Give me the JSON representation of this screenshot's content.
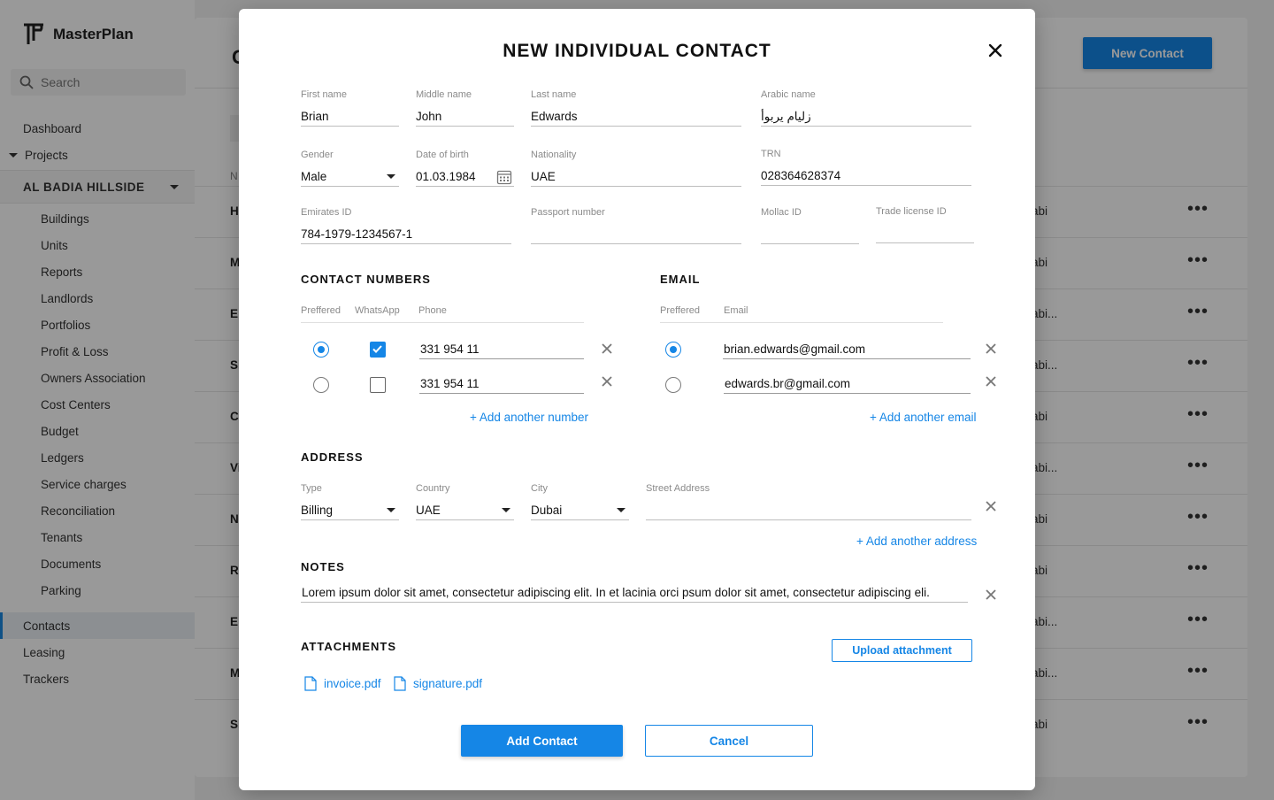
{
  "app": {
    "brand": "MasterPlan",
    "search_placeholder": "Search",
    "nav": {
      "dashboard": "Dashboard",
      "projects": "Projects",
      "project_name": "AL BADIA HILLSIDE",
      "project_items": [
        "Buildings",
        "Units",
        "Reports",
        "Landlords",
        "Portfolios",
        "Profit & Loss",
        "Owners Association",
        "Cost Centers",
        "Budget",
        "Ledgers",
        "Service charges",
        "Reconciliation",
        "Tenants",
        "Documents",
        "Parking"
      ],
      "contacts": "Contacts",
      "leasing": "Leasing",
      "trackers": "Trackers"
    },
    "page_title": "C",
    "new_contact": "New Contact",
    "column_header": "N",
    "rows": [
      {
        "name": "H",
        "city": "abi"
      },
      {
        "name": "M",
        "city": "abi"
      },
      {
        "name": "E",
        "city": "abi..."
      },
      {
        "name": "Si",
        "city": "abi..."
      },
      {
        "name": "Cl",
        "city": "abi"
      },
      {
        "name": "Vi",
        "city": "abi..."
      },
      {
        "name": "N",
        "city": "abi"
      },
      {
        "name": "R",
        "city": "abi"
      },
      {
        "name": "E",
        "city": "abi..."
      },
      {
        "name": "M",
        "city": "abi..."
      },
      {
        "name": "Si",
        "city": "abi"
      }
    ],
    "row_more": "•••"
  },
  "modal": {
    "title": "NEW INDIVIDUAL CONTACT",
    "fields": {
      "first_name": {
        "label": "First name",
        "value": "Brian"
      },
      "middle_name": {
        "label": "Middle name",
        "value": "John"
      },
      "last_name": {
        "label": "Last name",
        "value": "Edwards"
      },
      "arabic_name": {
        "label": "Arabic name",
        "value": "زليام يربوأ"
      },
      "gender": {
        "label": "Gender",
        "value": "Male"
      },
      "dob": {
        "label": "Date of birth",
        "value": "01.03.1984"
      },
      "nationality": {
        "label": "Nationality",
        "value": "UAE"
      },
      "trn": {
        "label": "TRN",
        "value": "028364628374"
      },
      "emirates_id": {
        "label": "Emirates ID",
        "value": "784-1979-1234567-1"
      },
      "passport": {
        "label": "Passport number",
        "value": ""
      },
      "mollac": {
        "label": "Mollac ID",
        "value": ""
      },
      "trade_license": {
        "label": "Trade license ID",
        "value": ""
      }
    },
    "contact_numbers": {
      "title": "CONTACT NUMBERS",
      "headers": {
        "preferred": "Preffered",
        "whatsapp": "WhatsApp",
        "phone": "Phone"
      },
      "rows": [
        {
          "preferred": true,
          "whatsapp": true,
          "phone": "331 954 11"
        },
        {
          "preferred": false,
          "whatsapp": false,
          "phone": "331 954 11"
        }
      ],
      "add_link": "+ Add another number"
    },
    "email": {
      "title": "EMAIL",
      "headers": {
        "preferred": "Preffered",
        "email": "Email"
      },
      "rows": [
        {
          "preferred": true,
          "email": "brian.edwards@gmail.com"
        },
        {
          "preferred": false,
          "email": "edwards.br@gmail.com"
        }
      ],
      "add_link": "+ Add another email"
    },
    "address": {
      "title": "ADDRESS",
      "type": {
        "label": "Type",
        "value": "Billing"
      },
      "country": {
        "label": "Country",
        "value": "UAE"
      },
      "city": {
        "label": "City",
        "value": "Dubai"
      },
      "street": {
        "label": "Street Address",
        "value": ""
      },
      "add_link": "+ Add another address"
    },
    "notes": {
      "title": "NOTES",
      "value": "Lorem ipsum dolor sit amet, consectetur adipiscing elit. In et lacinia orci psum dolor sit amet, consectetur adipiscing eli."
    },
    "attachments": {
      "title": "ATTACHMENTS",
      "upload_label": "Upload attachment",
      "files": [
        "invoice.pdf",
        "signature.pdf"
      ]
    },
    "add_contact": "Add Contact",
    "cancel": "Cancel"
  },
  "colors": {
    "accent": "#1586e6",
    "overlay": "rgba(0,0,0,0.4)"
  }
}
